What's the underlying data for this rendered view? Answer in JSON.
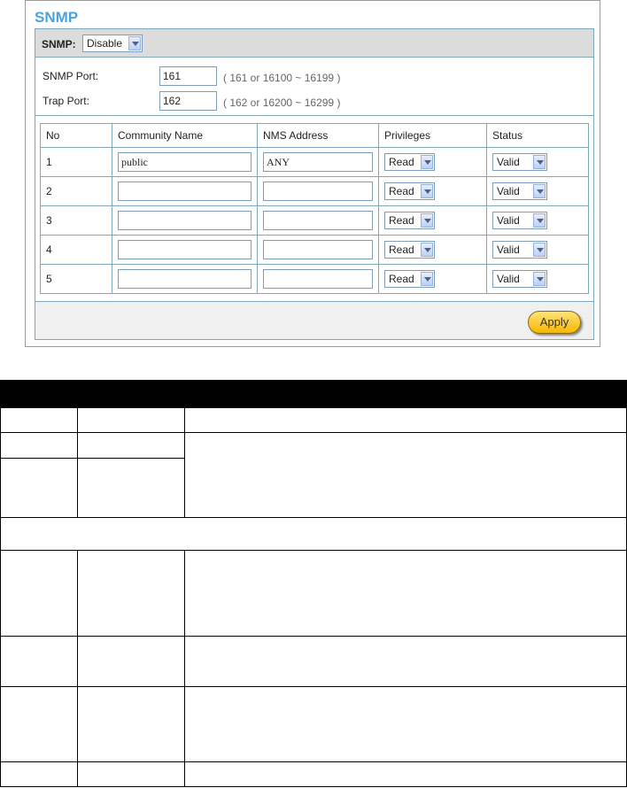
{
  "page": {
    "title": "SNMP"
  },
  "snmp": {
    "label": "SNMP:",
    "selected": "Disable"
  },
  "ports": {
    "snmp_port_label": "SNMP Port:",
    "snmp_port_value": "161",
    "snmp_port_hint": "( 161 or 16100 ~ 16199 )",
    "trap_port_label": "Trap Port:",
    "trap_port_value": "162",
    "trap_port_hint": "( 162 or 16200 ~ 16299 )"
  },
  "table": {
    "headers": [
      "No",
      "Community Name",
      "NMS Address",
      "Privileges",
      "Status"
    ],
    "rows": [
      {
        "no": "1",
        "community": "public",
        "nms": "ANY",
        "privileges": "Read",
        "status": "Valid"
      },
      {
        "no": "2",
        "community": "",
        "nms": "",
        "privileges": "Read",
        "status": "Valid"
      },
      {
        "no": "3",
        "community": "",
        "nms": "",
        "privileges": "Read",
        "status": "Valid"
      },
      {
        "no": "4",
        "community": "",
        "nms": "",
        "privileges": "Read",
        "status": "Valid"
      },
      {
        "no": "5",
        "community": "",
        "nms": "",
        "privileges": "Read",
        "status": "Valid"
      }
    ]
  },
  "footer": {
    "apply_label": "Apply"
  },
  "colors": {
    "title": "#4aa3df",
    "panel_border": "#7fa9b8",
    "apply_button": "#f7b800"
  }
}
